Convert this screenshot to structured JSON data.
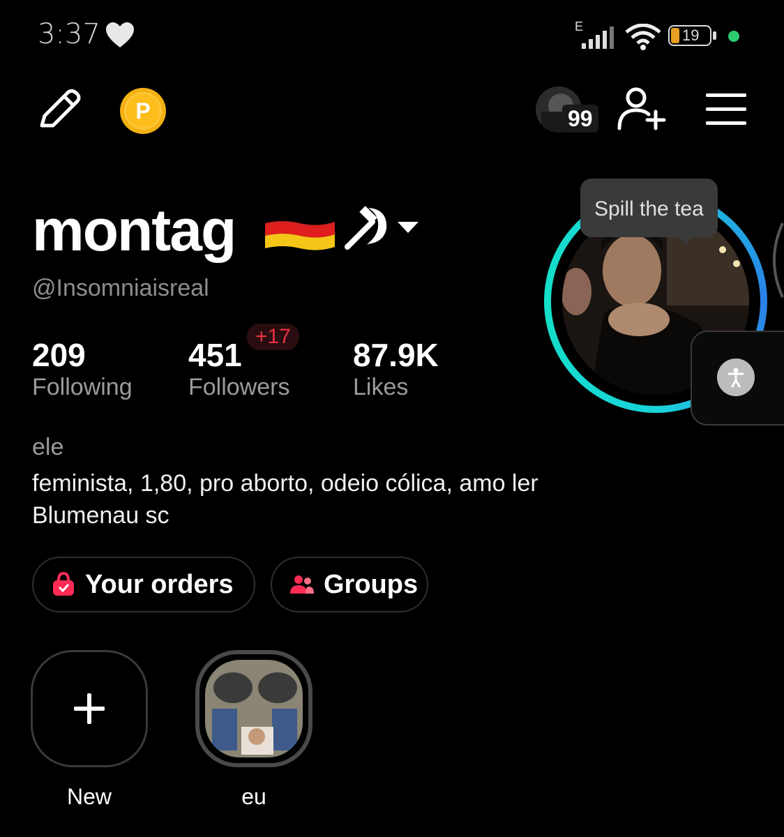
{
  "status_bar": {
    "time": "3:37",
    "network_label": "E",
    "battery": "19",
    "dot_color": "#2ecc71"
  },
  "top_bar": {
    "coin_label": "P",
    "notification_count": "99"
  },
  "profile": {
    "display_name": "montag",
    "handle": "@Insomniaisreal",
    "tooltip": "Spill the tea"
  },
  "stats": {
    "following": {
      "value": "209",
      "label": "Following"
    },
    "followers": {
      "value": "451",
      "label": "Followers",
      "delta": "+17"
    },
    "likes": {
      "value": "87.9K",
      "label": "Likes"
    }
  },
  "bio": {
    "line1": "ele",
    "line2": "feminista, 1,80, pro aborto, odeio cólica, amo ler",
    "line3": "Blumenau sc"
  },
  "buttons": {
    "orders": "Your orders",
    "groups": "Groups"
  },
  "highlights": [
    {
      "label": "New"
    },
    {
      "label": "eu"
    }
  ],
  "colors": {
    "accent_pink": "#fe2c55",
    "coin": "#f3b213",
    "ring": "#19d3da"
  }
}
